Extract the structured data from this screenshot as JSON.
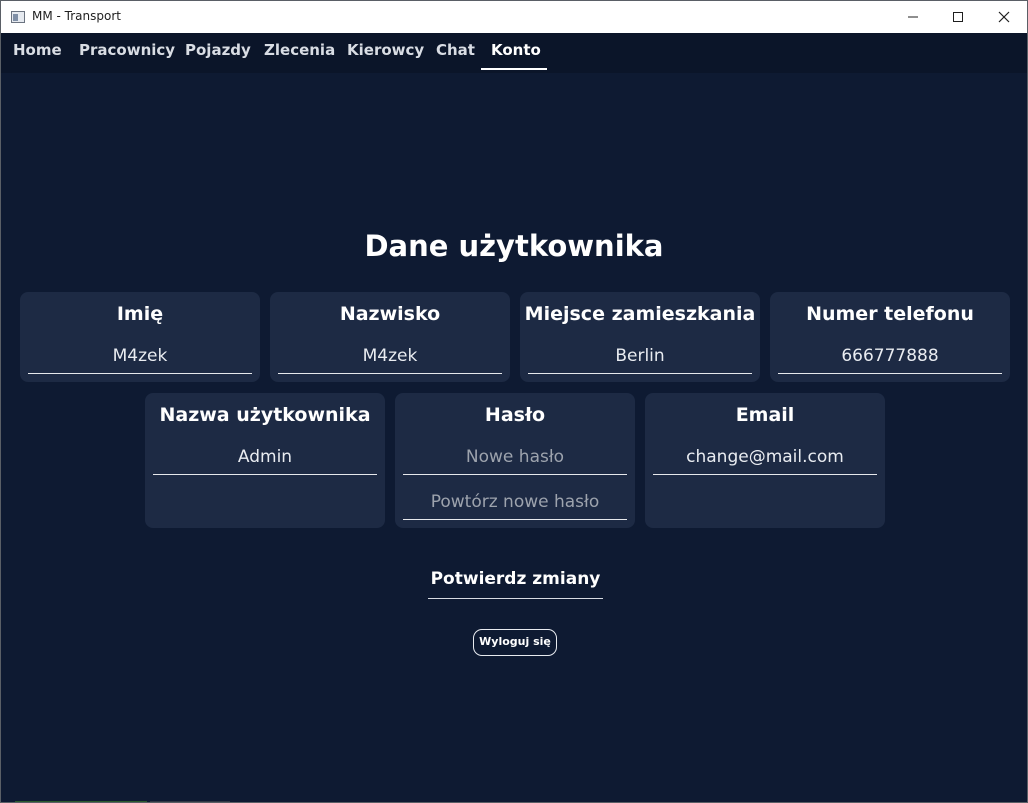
{
  "window": {
    "title": "MM - Transport"
  },
  "nav": {
    "items": [
      {
        "label": "Home"
      },
      {
        "label": "Pracownicy"
      },
      {
        "label": "Pojazdy"
      },
      {
        "label": "Zlecenia"
      },
      {
        "label": "Kierowcy"
      },
      {
        "label": "Chat"
      },
      {
        "label": "Konto"
      }
    ],
    "active": "Konto"
  },
  "page": {
    "title": "Dane użytkownika"
  },
  "cards": {
    "imie": {
      "label": "Imię",
      "value": "M4zek"
    },
    "nazwisko": {
      "label": "Nazwisko",
      "value": "M4zek"
    },
    "miejsce": {
      "label": "Miejsce zamieszkania",
      "value": "Berlin"
    },
    "telefon": {
      "label": "Numer telefonu",
      "value": "666777888"
    },
    "username": {
      "label": "Nazwa użytkownika",
      "value": "Admin"
    },
    "haslo": {
      "label": "Hasło",
      "new_placeholder": "Nowe hasło",
      "repeat_placeholder": "Powtórz nowe hasło"
    },
    "email": {
      "label": "Email",
      "value": "change@mail.com"
    }
  },
  "actions": {
    "confirm_label": "Potwierdz zmiany",
    "logout_label": "Wyloguj się"
  },
  "colors": {
    "background": "#0e1a32",
    "card": "#1d2a44",
    "navbar": "#0b1529",
    "text": "#ffffff"
  }
}
